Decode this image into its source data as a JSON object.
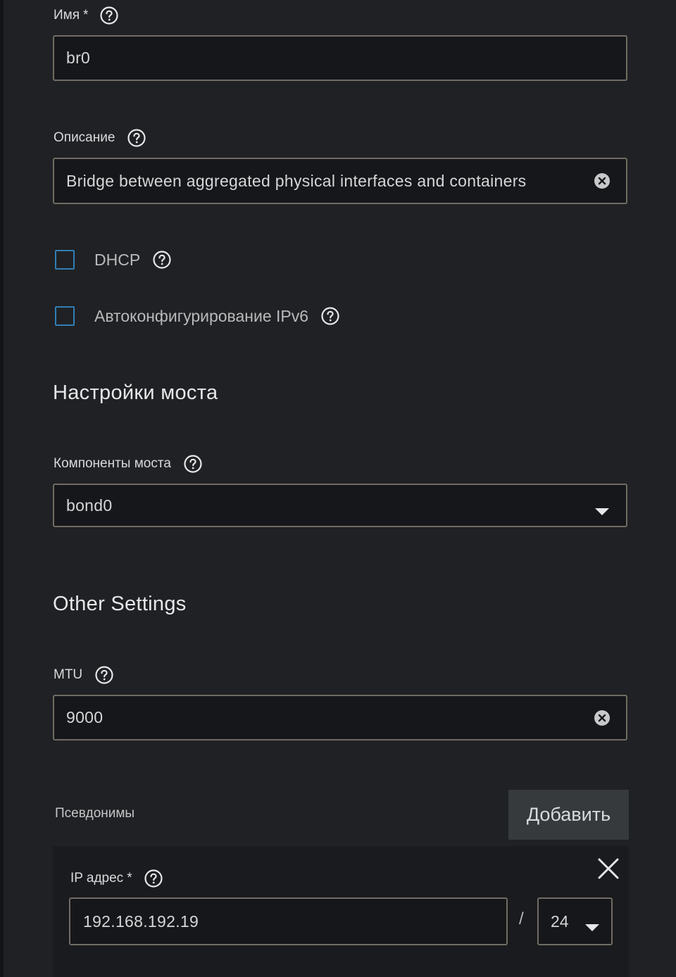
{
  "name_field": {
    "label": "Имя",
    "required_mark": "*",
    "value": "br0"
  },
  "description_field": {
    "label": "Описание",
    "value": "Bridge between aggregated physical interfaces and containers"
  },
  "dhcp": {
    "label": "DHCP",
    "checked": false
  },
  "ipv6_autoconfig": {
    "label": "Автоконфигурирование IPv6",
    "checked": false
  },
  "bridge_settings": {
    "title": "Настройки моста",
    "members_label": "Компоненты моста",
    "members_value": "bond0"
  },
  "other_settings": {
    "title": "Other Settings",
    "mtu_label": "MTU",
    "mtu_value": "9000"
  },
  "aliases": {
    "label": "Псевдонимы",
    "add_button": "Добавить",
    "items": [
      {
        "ip_label": "IP адрес",
        "required_mark": "*",
        "ip_value": "192.168.192.19",
        "separator": "/",
        "netmask_value": "24"
      }
    ]
  },
  "colors": {
    "background": "#202124",
    "input_background": "#16171a",
    "input_border": "#6f6c63",
    "checkbox_border": "#2f7fb5",
    "button_background": "#363a3d"
  },
  "icons": {
    "help": "question-circle-icon",
    "clear": "clear-circle-icon",
    "dropdown": "caret-down-icon",
    "remove": "close-icon"
  }
}
